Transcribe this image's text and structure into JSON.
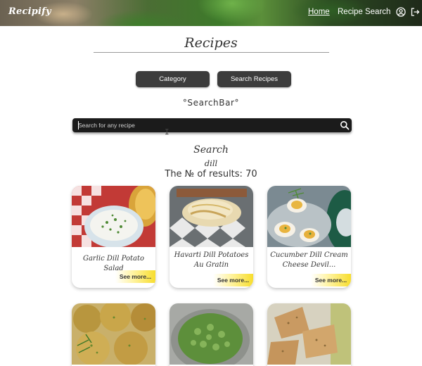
{
  "header": {
    "logo": "Recipify",
    "nav": {
      "home": "Home",
      "recipe_search": "Recipe Search"
    }
  },
  "page": {
    "title": "Recipes"
  },
  "modes": {
    "category": "Category",
    "search": "Search Recipes"
  },
  "searchbar": {
    "label": "°SearchBar°",
    "placeholder": "Search for any recipe",
    "value": ""
  },
  "results": {
    "heading": "Search",
    "term": "dill",
    "count_text": "The № of results: 70"
  },
  "cards": [
    {
      "title": "Garlic Dill Potato Salad",
      "button": "See more..."
    },
    {
      "title": "Havarti Dill Potatoes Au Gratin",
      "button": "See more..."
    },
    {
      "title": "Cucumber Dill Cream Cheese Devil...",
      "button": "See more..."
    },
    {
      "title": "",
      "button": ""
    },
    {
      "title": "",
      "button": ""
    },
    {
      "title": "",
      "button": ""
    }
  ],
  "colors": {
    "button_bg": "#3c3c3c",
    "searchbar_bg": "#1b1b1b",
    "see_more_accent": "#f7dd2e"
  },
  "icons": {
    "account": "user-circle-icon",
    "logout": "logout-icon",
    "search": "magnifier-icon"
  }
}
